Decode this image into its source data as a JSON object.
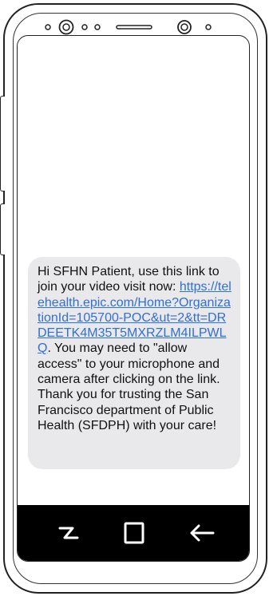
{
  "message": {
    "text_before_link": "Hi SFHN Patient, use this link to join your video visit now: ",
    "link": "https://telehealth.epic.com/Home?OrganizationId=105700-POC&ut=2&tt=DRDEETK4M35T5MXRZLM4ILPWLQ",
    "text_after_link": ". You may need to \"allow access\" to your microphone and camera after clicking on the link.  Thank you for trusting the San Francisco department of Public Health (SFDPH) with your care!"
  },
  "nav": {
    "recent_icon": "recent-apps-icon",
    "home_icon": "home-icon",
    "back_icon": "back-arrow-icon"
  }
}
